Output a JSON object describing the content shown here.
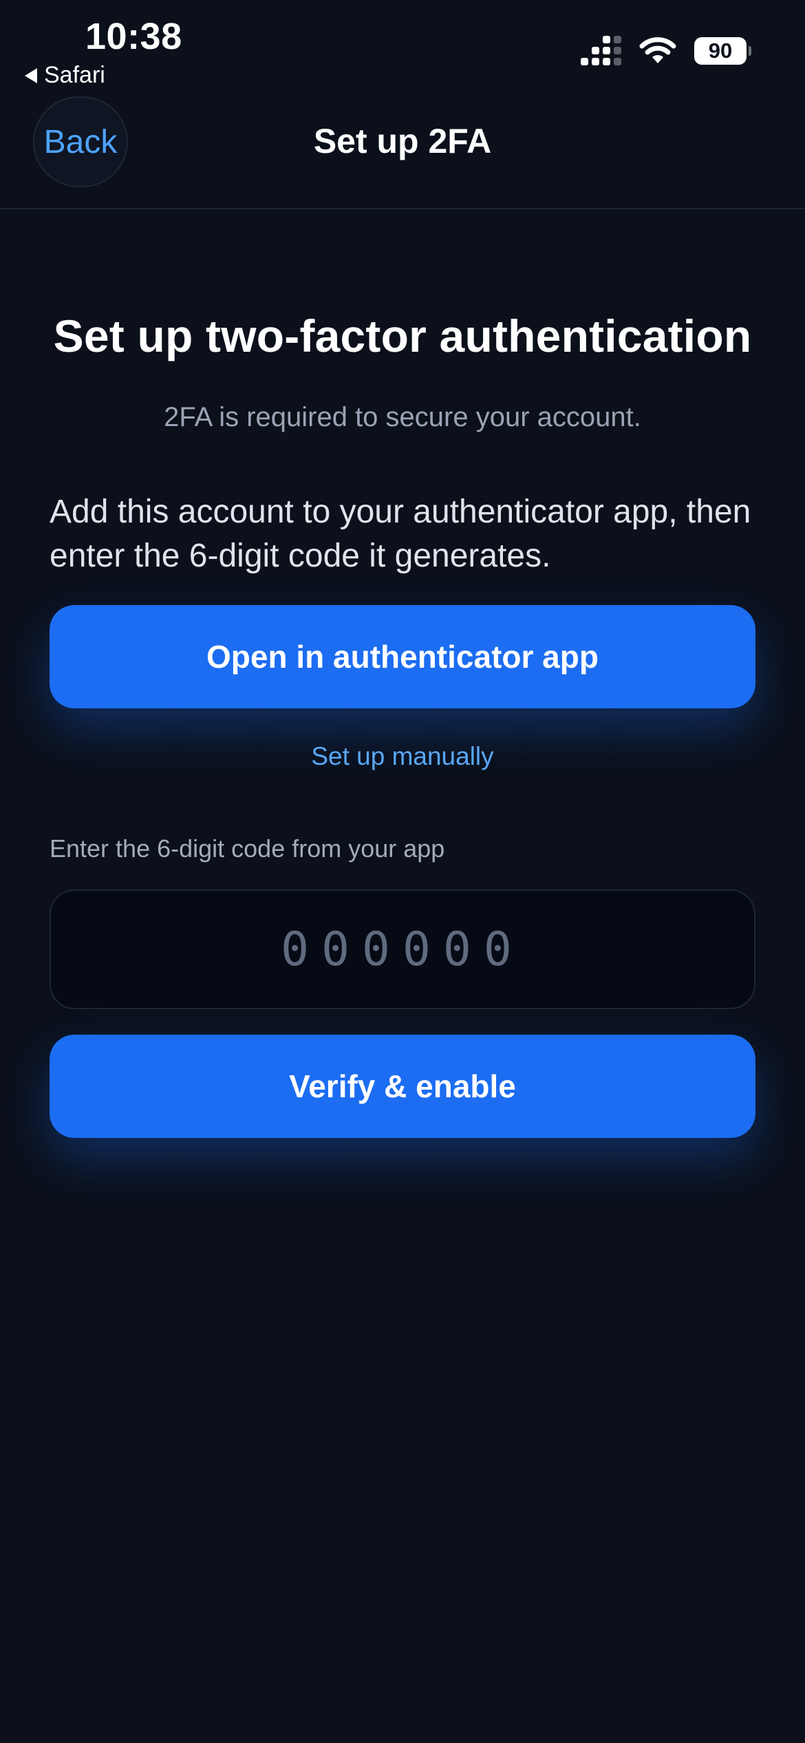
{
  "status_bar": {
    "time": "10:38",
    "back_app": "Safari",
    "battery": "90",
    "icons": [
      "cellular-signal-icon",
      "wifi-icon",
      "battery-icon"
    ]
  },
  "nav": {
    "back_label": "Back",
    "title": "Set up 2FA"
  },
  "main": {
    "heading": "Set up two-factor authentication",
    "subheading": "2FA is required to secure your account.",
    "instructions": "Add this account to your authenticator app, then enter the 6-digit code it generates.",
    "open_button": "Open in authenticator app",
    "manual_link": "Set up manually",
    "code_label": "Enter the 6-digit code from your app",
    "code_placeholder": "000000",
    "code_value": "",
    "verify_button": "Verify & enable"
  },
  "colors": {
    "background": "#0b101b",
    "accent": "#1c6df2",
    "link": "#4da3ff",
    "muted_text": "#9ba4b4"
  }
}
